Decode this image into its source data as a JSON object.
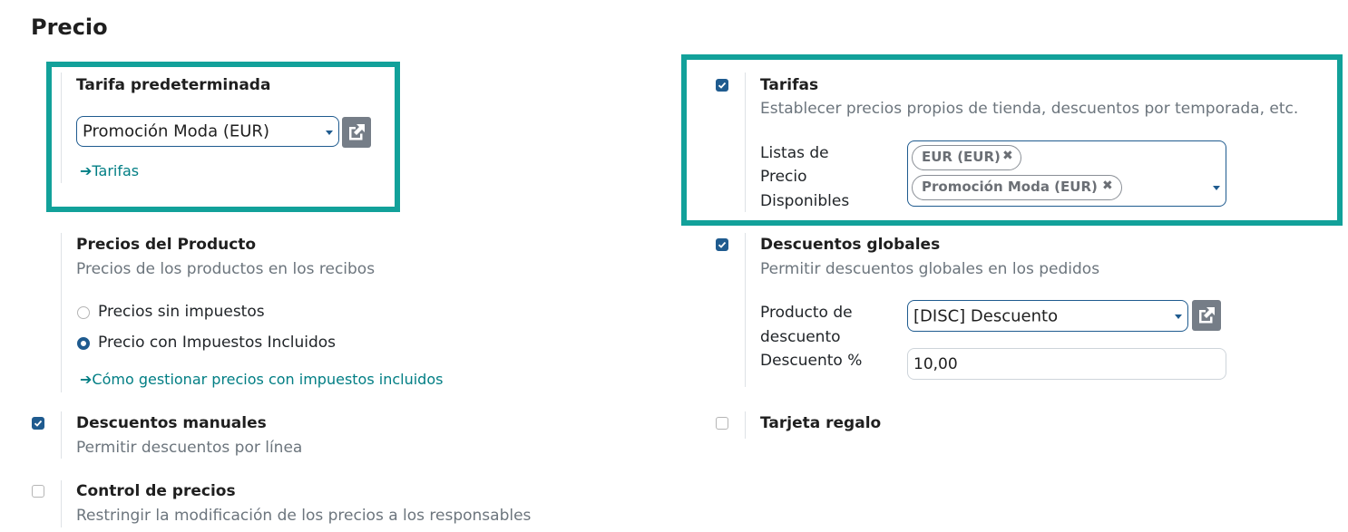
{
  "section_title": "Precio",
  "default_pricelist": {
    "label": "Tarifa predeterminada",
    "value": "Promoción Moda (EUR)",
    "link": "Tarifas"
  },
  "pricelists": {
    "label": "Tarifas",
    "description": "Establecer precios propios de tienda, descuentos por temporada, etc.",
    "field_label_lines": [
      "Listas de",
      "Precio",
      "Disponibles"
    ],
    "tags": [
      "EUR (EUR)",
      "Promoción Moda (EUR)"
    ],
    "tag_remove": "✖"
  },
  "product_prices": {
    "label": "Precios del Producto",
    "description": "Precios de los productos en los recibos",
    "options": [
      "Precios sin impuestos",
      "Precio con Impuestos Incluidos"
    ],
    "selected_index": 1,
    "link": "Cómo gestionar precios con impuestos incluidos"
  },
  "global_discounts": {
    "label": "Descuentos globales",
    "description": "Permitir descuentos globales en los pedidos",
    "product_label_lines": [
      "Producto de",
      "descuento"
    ],
    "product_value": "[DISC] Descuento",
    "percent_label": "Descuento %",
    "percent_value": "10,00"
  },
  "manual_discounts": {
    "label": "Descuentos manuales",
    "description": "Permitir descuentos por línea"
  },
  "gift_card": {
    "label": "Tarjeta regalo"
  },
  "price_control": {
    "label": "Control de precios",
    "description": "Restringir la modificación de los precios a los responsables"
  },
  "checkboxes": {
    "pricelists": true,
    "global_discounts": true,
    "manual_discounts": true,
    "gift_card": false,
    "price_control": false
  },
  "colors": {
    "accent": "#12a19a",
    "checkbox": "#1f5b8f",
    "link": "#017e84"
  }
}
